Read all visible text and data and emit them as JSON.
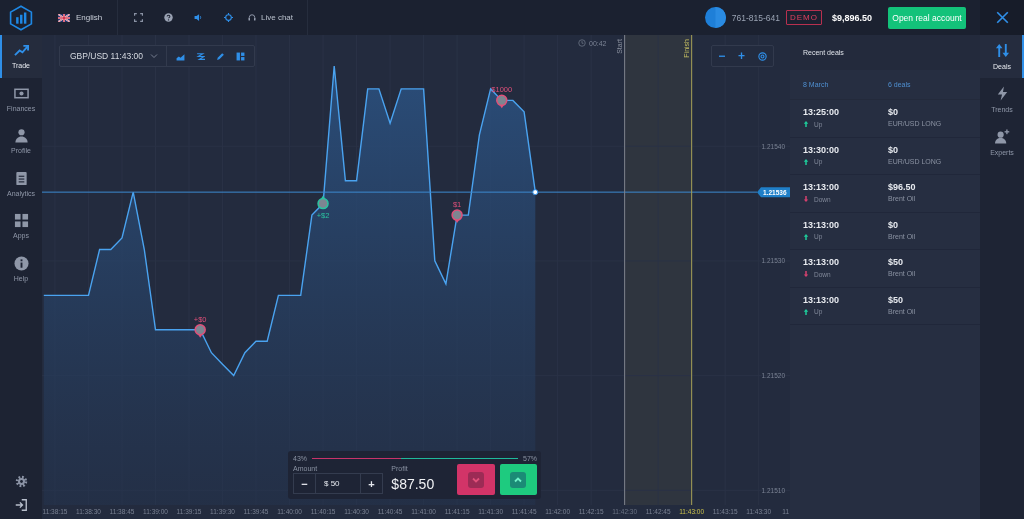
{
  "topbar": {
    "language": "English",
    "live_chat": "Live chat",
    "account_id": "761-815-641",
    "mode_badge": "DEMO",
    "balance": "$9,896.50",
    "open_account_button": "Open real account"
  },
  "sidebar": {
    "items": [
      {
        "label": "Trade",
        "kind": "trade",
        "selected": true
      },
      {
        "label": "Finances",
        "kind": "finances",
        "selected": false
      },
      {
        "label": "Profile",
        "kind": "profile",
        "selected": false
      },
      {
        "label": "Analytics",
        "kind": "analytics",
        "selected": false
      },
      {
        "label": "Apps",
        "kind": "apps",
        "selected": false
      },
      {
        "label": "Help",
        "kind": "help",
        "selected": false
      }
    ]
  },
  "chart": {
    "instrument": "GBP/USD 11:43:00",
    "zoom_controls": [
      "−",
      "+"
    ],
    "timer": "00:42",
    "deal_markers": [
      {
        "text": "+$0",
        "kind": "down"
      },
      {
        "text": "+$2",
        "kind": "up"
      },
      {
        "text": "$1",
        "kind": "down"
      },
      {
        "text": "$1000",
        "kind": "down"
      }
    ],
    "chart_data": {
      "type": "area",
      "categories": [
        null,
        "11:38:15",
        null,
        null,
        "11:38:30",
        null,
        null,
        "11:38:45",
        null,
        null,
        "11:39:00",
        null,
        null,
        "11:39:15",
        null,
        null,
        "11:39:30",
        null,
        null,
        "11:39:45",
        null,
        null,
        "11:40:00",
        null,
        null,
        "11:40:15",
        null,
        null,
        "11:40:30",
        null,
        null,
        "11:40:45",
        null,
        null,
        "11:41:00",
        null,
        null,
        "11:41:15",
        null,
        null,
        "11:41:30",
        null,
        null,
        "11:41:45",
        null,
        null,
        "11:42:00",
        null,
        null,
        "11:42:15",
        null,
        null,
        "11:42:30",
        null,
        null,
        "11:42:45",
        null,
        null,
        "11:43:00",
        null,
        null,
        "11:43:15",
        null,
        null,
        "11:43:30",
        null,
        null,
        "11"
      ],
      "series": [
        {
          "color": "#4aa3f0",
          "values": [
            1.21527,
            1.21527,
            1.21527,
            1.21527,
            1.21527,
            1.21531,
            1.21531,
            1.21532,
            1.21536,
            1.21531,
            1.21524,
            1.21524,
            1.21524,
            1.21524,
            1.21524,
            1.21522,
            1.21521,
            1.2152,
            1.21522,
            1.21523,
            1.21523,
            1.21527,
            1.21527,
            1.21527,
            1.21534,
            1.21535,
            1.21547,
            1.21537,
            1.21537,
            1.21545,
            1.21545,
            1.21542,
            1.21545,
            1.21545,
            1.21545,
            1.2153,
            1.21528,
            1.21534,
            1.21534,
            1.21541,
            1.21545,
            1.21544,
            1.21544,
            1.21543,
            1.21536,
            null,
            null,
            null,
            null,
            null,
            null,
            null,
            null,
            null,
            null,
            null,
            null,
            null,
            null,
            null,
            null,
            null,
            null,
            null,
            null,
            null,
            null,
            null
          ]
        }
      ],
      "ylim": [
        1.215075,
        1.215497
      ],
      "yticks": [
        {
          "value": 1.2151,
          "label": "1.21510"
        },
        {
          "value": 1.2152,
          "label": "1.21520"
        },
        {
          "value": 1.2153,
          "label": "1.21530"
        },
        {
          "value": 1.2154,
          "label": "1.21540"
        }
      ],
      "grid": true,
      "ref_lines": [
        {
          "axis": "x",
          "value": "11:42:30",
          "label": "Start"
        },
        {
          "axis": "x",
          "value": "11:43:00",
          "label": "Finish"
        },
        {
          "axis": "y",
          "value": 1.21536,
          "label": "1.21536"
        }
      ]
    }
  },
  "trade_panel": {
    "down_share": "43%",
    "up_share": "57%",
    "level": 0.43,
    "amount_label": "Amount",
    "minus": "−",
    "amount": "$ 50",
    "plus": "+",
    "profit_label": "Profit",
    "profit": "$87.50"
  },
  "deals": {
    "title": "Recent deals",
    "date": "8 March",
    "count": "6 deals",
    "rows": [
      {
        "time": "13:25:00",
        "kind": "up",
        "direction": "Up",
        "amount": "$0",
        "asset": "EUR/USD LONG"
      },
      {
        "time": "13:30:00",
        "kind": "up",
        "direction": "Up",
        "amount": "$0",
        "asset": "EUR/USD LONG"
      },
      {
        "time": "13:13:00",
        "kind": "down",
        "direction": "Down",
        "amount": "$96.50",
        "asset": "Brent Oil"
      },
      {
        "time": "13:13:00",
        "kind": "up",
        "direction": "Up",
        "amount": "$0",
        "asset": "Brent Oil"
      },
      {
        "time": "13:13:00",
        "kind": "down",
        "direction": "Down",
        "amount": "$50",
        "asset": "Brent Oil"
      },
      {
        "time": "13:13:00",
        "kind": "up",
        "direction": "Up",
        "amount": "$50",
        "asset": "Brent Oil"
      }
    ]
  },
  "right_nav": {
    "items": [
      {
        "label": "Deals",
        "kind": "deals",
        "selected": true
      },
      {
        "label": "Trends",
        "kind": "trends",
        "selected": false
      },
      {
        "label": "Experts",
        "kind": "experts",
        "selected": false
      }
    ]
  }
}
